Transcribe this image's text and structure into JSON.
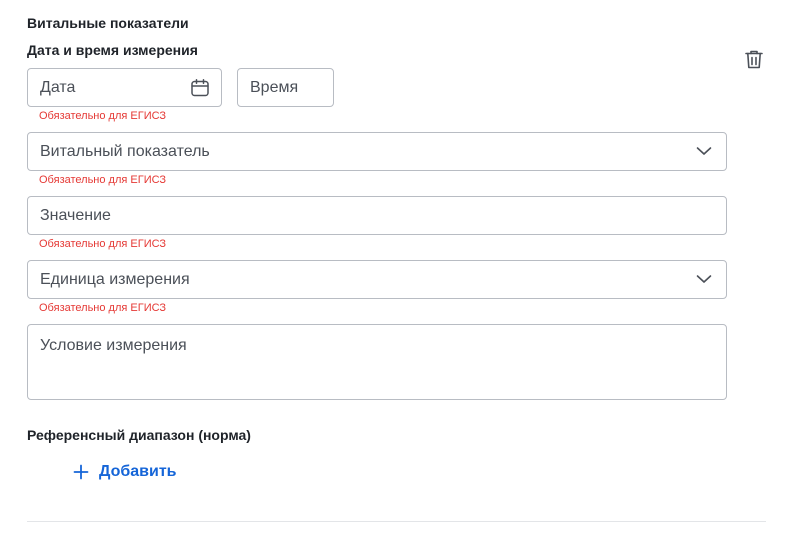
{
  "section": {
    "title": "Витальные показатели"
  },
  "measurement": {
    "title": "Дата и время измерения",
    "date_placeholder": "Дата",
    "time_placeholder": "Время",
    "error": "Обязательно для ЕГИСЗ"
  },
  "vital": {
    "placeholder": "Витальный показатель",
    "error": "Обязательно для ЕГИСЗ"
  },
  "value": {
    "placeholder": "Значение",
    "error": "Обязательно для ЕГИСЗ"
  },
  "unit": {
    "placeholder": "Единица измерения",
    "error": "Обязательно для ЕГИСЗ"
  },
  "condition": {
    "placeholder": "Условие измерения"
  },
  "reference": {
    "title": "Референсный диапазон (норма)",
    "add_label": "Добавить"
  },
  "icons": [
    "calendar-icon",
    "chevron-down-icon",
    "trash-icon",
    "plus-icon"
  ],
  "colors": {
    "accent": "#1565d8",
    "error": "#e53935",
    "border": "#b8bcc3"
  }
}
